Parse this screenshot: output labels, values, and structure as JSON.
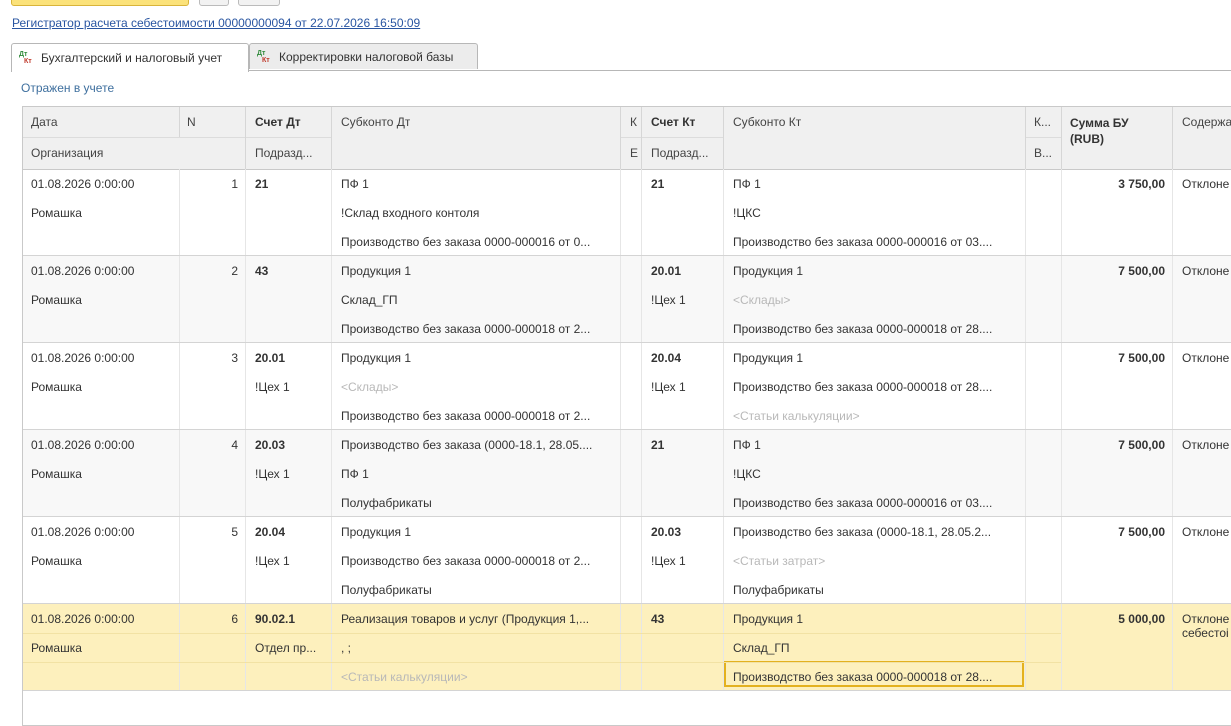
{
  "register_link": "Регистратор расчета себестоимости 00000000094 от 22.07.2026 16:50:09",
  "tabs": [
    {
      "label": "Бухгалтерский и налоговый учет",
      "active": true,
      "icon": "dt-kt-icon"
    },
    {
      "label": "Корректировки налоговой базы",
      "active": false,
      "icon": "dt-kt-icon"
    }
  ],
  "status": "Отражен в учете",
  "columns": {
    "date": "Дата",
    "org": "Организация",
    "n": "N",
    "acc_dt": "Счет Дт",
    "dept_dt": "Подразд...",
    "sub_dt": "Субконто Дт",
    "k1": "К",
    "k1b": "Е",
    "acc_kt": "Счет Кт",
    "dept_kt": "Подразд...",
    "sub_kt": "Субконто Кт",
    "k2": "К...",
    "k2b": "В...",
    "sum": "Сумма БУ (RUB)",
    "content": "Содержа"
  },
  "rows": [
    {
      "date": "01.08.2026 0:00:00",
      "org": "Ромашка",
      "n": "1",
      "acc_dt": "21",
      "dept_dt": "",
      "sub_dt": [
        "ПФ 1",
        "!Склад входного контоля",
        "Производство без заказа 0000-000016 от 0..."
      ],
      "acc_kt": "21",
      "dept_kt": "",
      "sub_kt": [
        "ПФ 1",
        "!ЦКС",
        "Производство без заказа 0000-000016 от 03...."
      ],
      "sum": "3 750,00",
      "content": "Отклоне",
      "content2": ""
    },
    {
      "date": "01.08.2026 0:00:00",
      "org": "Ромашка",
      "n": "2",
      "acc_dt": "43",
      "dept_dt": "",
      "sub_dt": [
        "Продукция 1",
        "Склад_ГП",
        "Производство без заказа 0000-000018 от 2..."
      ],
      "acc_kt": "20.01",
      "dept_kt": "!Цех 1",
      "sub_kt": [
        "Продукция 1",
        "<Склады>",
        "Производство без заказа 0000-000018 от 28...."
      ],
      "sum": "7 500,00",
      "content": "Отклоне",
      "content2": ""
    },
    {
      "date": "01.08.2026 0:00:00",
      "org": "Ромашка",
      "n": "3",
      "acc_dt": "20.01",
      "dept_dt": "!Цех 1",
      "sub_dt": [
        "Продукция 1",
        "<Склады>",
        "Производство без заказа 0000-000018 от 2..."
      ],
      "acc_kt": "20.04",
      "dept_kt": "!Цех 1",
      "sub_kt": [
        "Продукция 1",
        "Производство без заказа 0000-000018 от 28....",
        "<Статьи калькуляции>"
      ],
      "sum": "7 500,00",
      "content": "Отклоне",
      "content2": ""
    },
    {
      "date": "01.08.2026 0:00:00",
      "org": "Ромашка",
      "n": "4",
      "acc_dt": "20.03",
      "dept_dt": "!Цех 1",
      "sub_dt": [
        "Производство без заказа (0000-18.1, 28.05....",
        "ПФ 1",
        "Полуфабрикаты"
      ],
      "acc_kt": "21",
      "dept_kt": "",
      "sub_kt": [
        "ПФ 1",
        "!ЦКС",
        "Производство без заказа 0000-000016 от 03...."
      ],
      "sum": "7 500,00",
      "content": "Отклоне",
      "content2": ""
    },
    {
      "date": "01.08.2026 0:00:00",
      "org": "Ромашка",
      "n": "5",
      "acc_dt": "20.04",
      "dept_dt": "!Цех 1",
      "sub_dt": [
        "Продукция 1",
        "Производство без заказа 0000-000018 от 2...",
        "Полуфабрикаты"
      ],
      "acc_kt": "20.03",
      "dept_kt": "!Цех 1",
      "sub_kt": [
        "Производство без заказа (0000-18.1, 28.05.2...",
        "<Статьи затрат>",
        "Полуфабрикаты"
      ],
      "sum": "7 500,00",
      "content": "Отклоне",
      "content2": ""
    },
    {
      "date": "01.08.2026 0:00:00",
      "org": "Ромашка",
      "n": "6",
      "acc_dt": "90.02.1",
      "dept_dt": "Отдел пр...",
      "sub_dt": [
        "Реализация товаров и услуг (Продукция 1,...",
        ", ;",
        "<Статьи калькуляции>"
      ],
      "acc_kt": "43",
      "dept_kt": "",
      "sub_kt": [
        "Продукция 1",
        "Склад_ГП",
        "Производство без заказа 0000-000018 от 28...."
      ],
      "sum": "5 000,00",
      "content": "Отклоне",
      "content2": "себестоі"
    }
  ],
  "selected_row": 5,
  "colors": {
    "accent_yellow": "#fbe27a",
    "selected_row": "#fdf0bd",
    "link": "#2955a1",
    "status": "#3e6f9e"
  }
}
